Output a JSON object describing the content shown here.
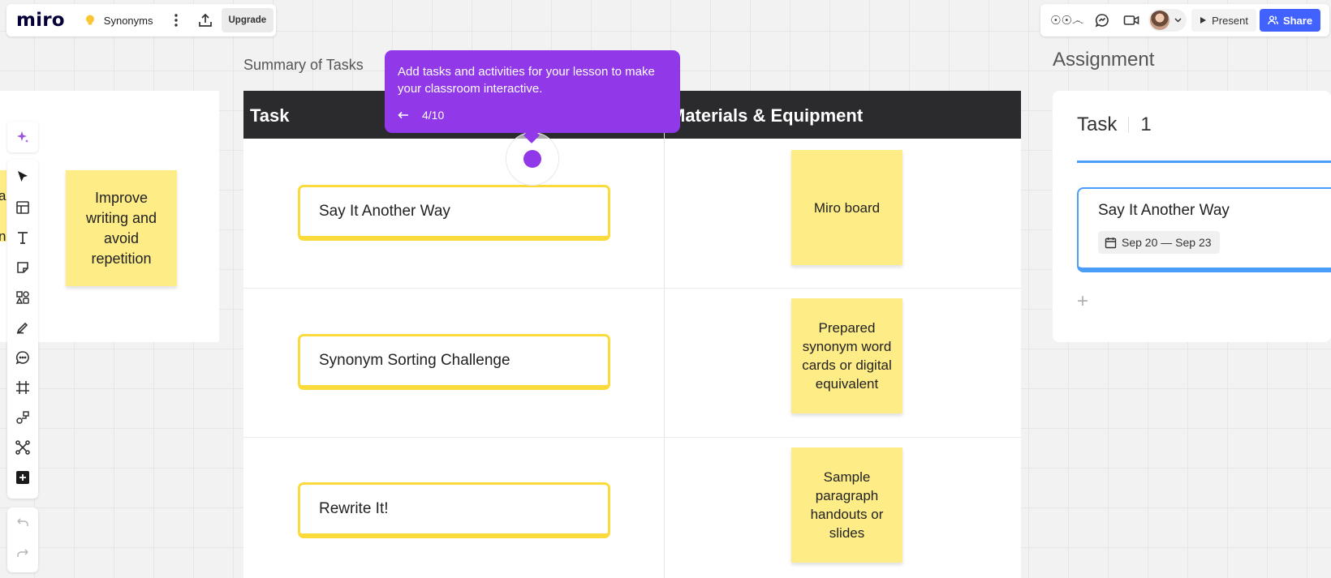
{
  "app": {
    "logo": "miro",
    "board_name": "Synonyms",
    "upgrade_label": "Upgrade"
  },
  "toolbar_right": {
    "reactions_label": "☉☉෴",
    "present_label": "Present",
    "share_label": "Share"
  },
  "left_panel": {
    "sticky_text": "Improve writing and avoid repetition",
    "partial_letters": [
      "a",
      "n"
    ]
  },
  "summary": {
    "title": "Summary of Tasks",
    "headers": [
      "Task",
      "Materials & Equipment"
    ],
    "rows": [
      {
        "task": "Say It Another Way",
        "materials": "Miro board"
      },
      {
        "task": "Synonym Sorting Challenge",
        "materials": "Prepared synonym word cards or digital equivalent"
      },
      {
        "task": "Rewrite It!",
        "materials": "Sample paragraph handouts or slides"
      }
    ]
  },
  "tooltip": {
    "text": "Add tasks and activities for your lesson to make your classroom interactive.",
    "step": "4/10"
  },
  "assignment": {
    "title": "Assignment",
    "task_label": "Task",
    "task_count": "1",
    "item_title": "Say It Another Way",
    "item_dates": "Sep 20 — Sep 23",
    "add_symbol": "+"
  },
  "colors": {
    "sticky_yellow": "#feec86",
    "task_border": "#fadb3b",
    "tooltip_purple": "#9138e8",
    "share_blue": "#4262ff",
    "assignment_blue": "#4a9df8",
    "table_header": "#2b2b2e"
  },
  "icons": {
    "bulb": "lightbulb-icon",
    "menu": "kebab-menu-icon",
    "export": "upload-icon",
    "chat": "chat-icon",
    "video": "video-icon",
    "present": "play-icon",
    "share": "people-icon",
    "tools": [
      "ai-sparkle-icon",
      "select-icon",
      "templates-icon",
      "text-icon",
      "sticky-note-icon",
      "shapes-icon",
      "pen-icon",
      "comment-icon",
      "frame-icon",
      "diagram-icon",
      "mindmap-icon",
      "more-apps-icon",
      "undo-icon",
      "redo-icon"
    ]
  }
}
